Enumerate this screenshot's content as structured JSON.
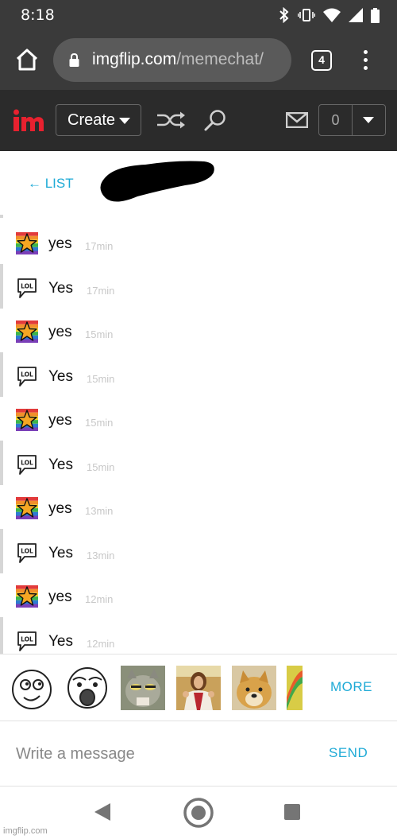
{
  "status": {
    "time": "8:18",
    "icons": [
      "bluetooth-icon",
      "vibrate-icon",
      "wifi-icon",
      "signal-icon",
      "battery-icon"
    ]
  },
  "browser": {
    "url_host": "imgflip.com",
    "url_path": "/memechat/",
    "tab_count": "4"
  },
  "nav": {
    "create_label": "Create",
    "notification_count": "0"
  },
  "chat": {
    "back_label": "← LIST",
    "messages": [
      {
        "sender": "star",
        "text": "yes",
        "time": "17min"
      },
      {
        "sender": "lol",
        "text": "Yes",
        "time": "17min"
      },
      {
        "sender": "star",
        "text": "yes",
        "time": "15min"
      },
      {
        "sender": "lol",
        "text": "Yes",
        "time": "15min"
      },
      {
        "sender": "star",
        "text": "yes",
        "time": "15min"
      },
      {
        "sender": "lol",
        "text": "Yes",
        "time": "15min"
      },
      {
        "sender": "star",
        "text": "yes",
        "time": "13min"
      },
      {
        "sender": "lol",
        "text": "Yes",
        "time": "13min"
      },
      {
        "sender": "star",
        "text": "yes",
        "time": "12min"
      },
      {
        "sender": "lol",
        "text": "Yes",
        "time": "12min"
      }
    ]
  },
  "memes": {
    "thumbnails": [
      "rage-face-smile",
      "rage-face-omg",
      "cat-meme",
      "jesus-meme",
      "doge-meme",
      "rainbow-meme"
    ],
    "more_label": "MORE"
  },
  "composer": {
    "placeholder": "Write a message",
    "send_label": "SEND"
  },
  "watermark": "imgflip.com",
  "colors": {
    "accent": "#1eaad6",
    "header_bg": "#3a3a3a",
    "nav_bg": "#2b2b2b",
    "logo_red": "#e8212f"
  }
}
